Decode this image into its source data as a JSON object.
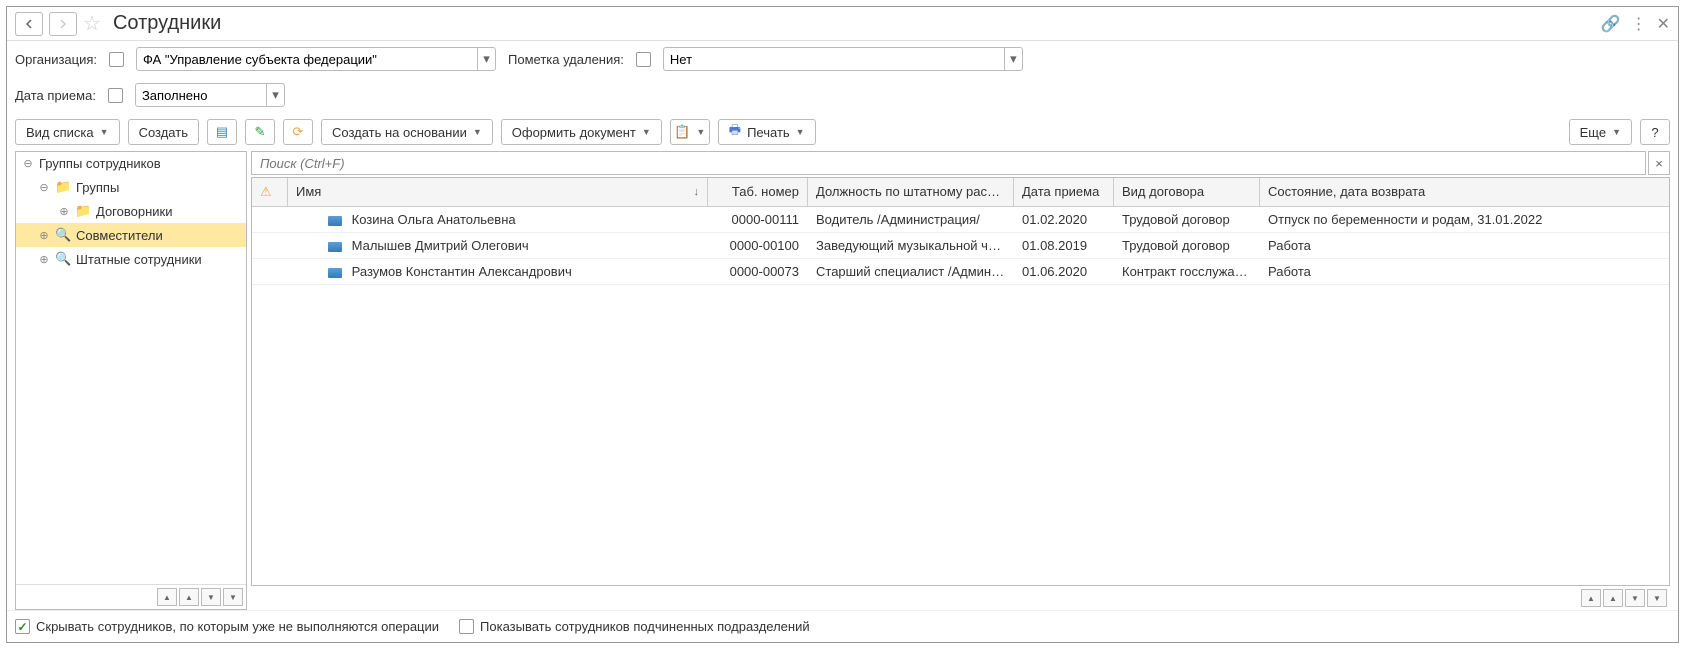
{
  "title": "Сотрудники",
  "filters": {
    "org_label": "Организация:",
    "org_value": "ФА \"Управление субъекта федерации\"",
    "del_label": "Пометка удаления:",
    "del_value": "Нет",
    "date_label": "Дата приема:",
    "date_value": "Заполнено"
  },
  "toolbar": {
    "view_type": "Вид списка",
    "create": "Создать",
    "create_based": "Создать на основании",
    "make_doc": "Оформить документ",
    "print": "Печать",
    "more": "Еще",
    "help": "?"
  },
  "search": {
    "placeholder": "Поиск (Ctrl+F)"
  },
  "tree": {
    "root": "Группы сотрудников",
    "groups": "Группы",
    "contractors": "Договорники",
    "part_time": "Совместители",
    "staff": "Штатные сотрудники"
  },
  "grid": {
    "headers": {
      "name": "Имя",
      "tab": "Таб. номер",
      "position": "Должность по штатному распис...",
      "date": "Дата приема",
      "contract": "Вид договора",
      "state": "Состояние, дата возврата"
    },
    "rows": [
      {
        "name": "Козина Ольга Анатольевна",
        "tab": "0000-00111",
        "pos": "Водитель /Администрация/",
        "date": "01.02.2020",
        "type": "Трудовой договор",
        "state": "Отпуск по беременности и родам, 31.01.2022"
      },
      {
        "name": "Малышев Дмитрий Олегович",
        "tab": "0000-00100",
        "pos": "Заведующий музыкальной част...",
        "date": "01.08.2019",
        "type": "Трудовой договор",
        "state": "Работа"
      },
      {
        "name": "Разумов Константин Александрович",
        "tab": "0000-00073",
        "pos": "Старший специалист /Админист...",
        "date": "01.06.2020",
        "type": "Контракт госслужащ...",
        "state": "Работа"
      }
    ]
  },
  "bottom": {
    "hide_inactive": "Скрывать сотрудников, по которым уже не выполняются операции",
    "show_sub": "Показывать сотрудников подчиненных подразделений"
  }
}
